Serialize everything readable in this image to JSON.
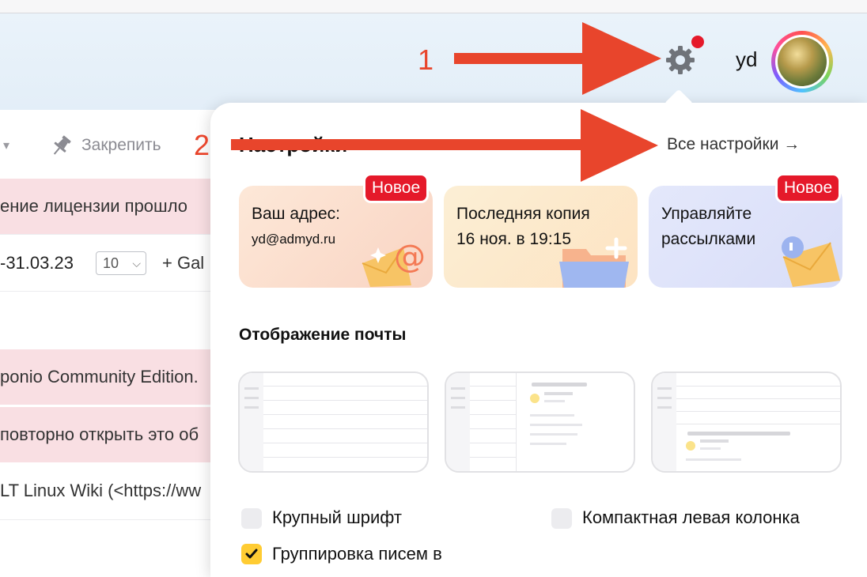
{
  "header": {
    "username": "yd"
  },
  "mail_list": {
    "toolbar": {
      "pin_label": "Закрепить"
    },
    "rows": [
      {
        "text": "ение лицензии прошло"
      },
      {
        "text": "ponio Community Edition."
      },
      {
        "text": "повторно открыть это об"
      },
      {
        "text": "LT Linux Wiki (<https://ww"
      }
    ],
    "date_range": "-31.03.23",
    "per_page": "10",
    "add_label": "+ Gal"
  },
  "settings": {
    "title": "Настройки",
    "all_settings_label": "Все настройки →",
    "cards": [
      {
        "line1": "Ваш адрес:",
        "line2": "yd@admyd.ru",
        "badge": "Новое"
      },
      {
        "line1": "Последняя копия",
        "line2": "16 ноя. в 19:15"
      },
      {
        "line1": "Управляйте",
        "line2": "рассылками",
        "badge": "Новое"
      }
    ],
    "display_section_title": "Отображение почты",
    "options": [
      {
        "label": "Крупный шрифт",
        "checked": false
      },
      {
        "label": "Компактная левая колонка",
        "checked": false
      },
      {
        "label": "Группировка писем в",
        "checked": true
      }
    ]
  },
  "annotations": {
    "marker1": "1",
    "marker2": "2",
    "color": "#e8452c"
  }
}
